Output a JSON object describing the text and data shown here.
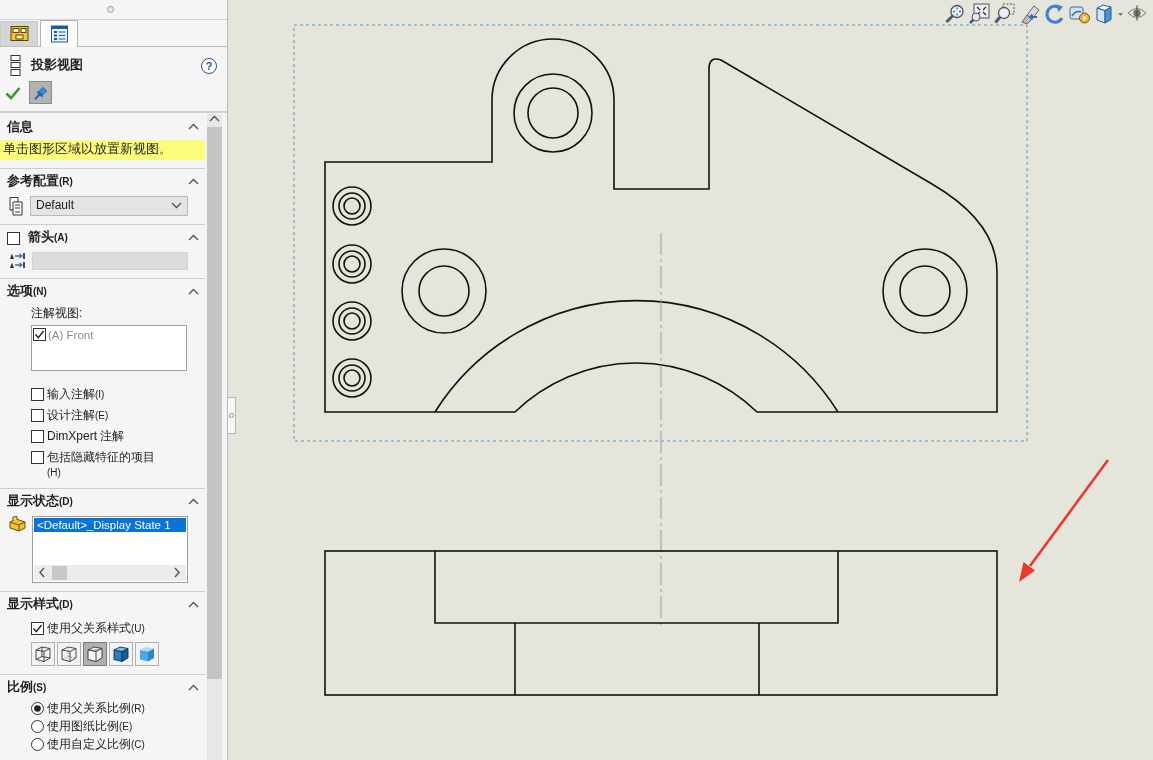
{
  "panel": {
    "tabs": [
      {
        "kind": "features",
        "selected": false
      },
      {
        "kind": "properties",
        "selected": true
      }
    ],
    "title": "投影视图",
    "help": "?",
    "pin_on": true,
    "sections": [
      {
        "title": "信息",
        "expanded": true,
        "controls": [
          {
            "kind": "message",
            "text": "单击图形区域以放置新视图。"
          }
        ]
      },
      {
        "title": "参考配置",
        "shortcut": "(R)",
        "expanded": true,
        "controls": [
          {
            "kind": "select",
            "value": "Default"
          }
        ]
      },
      {
        "title": "箭头",
        "shortcut": "(A)",
        "expanded": true,
        "header_checkbox": {
          "checked": false
        },
        "controls": [
          {
            "kind": "field",
            "disabled": true
          }
        ]
      },
      {
        "title": "选项",
        "shortcut": "(N)",
        "expanded": true,
        "controls": [
          {
            "kind": "label",
            "text": "注解视图:"
          },
          {
            "kind": "checklist",
            "items": [
              {
                "text": "(A) Front",
                "checked": true,
                "disabled": true
              }
            ]
          },
          {
            "kind": "checkbox",
            "text": "输入注解",
            "shortcut": "(I)",
            "checked": false
          },
          {
            "kind": "checkbox",
            "text": "设计注解",
            "shortcut": "(E)",
            "checked": false
          },
          {
            "kind": "checkbox",
            "text": "DimXpert 注解",
            "checked": false
          },
          {
            "kind": "checkbox",
            "text": "包括隐藏特征的项目",
            "shortcut": "(H)",
            "checked": false
          }
        ]
      },
      {
        "title": "显示状态",
        "shortcut": "(D)",
        "expanded": true,
        "controls": [
          {
            "kind": "listbox",
            "items": [
              {
                "text": "<Default>_Display State 1",
                "selected": true
              }
            ]
          }
        ]
      },
      {
        "title": "显示样式",
        "shortcut": "(D)",
        "expanded": true,
        "controls": [
          {
            "kind": "checkbox",
            "text": "使用父关系样式",
            "shortcut": "(U)",
            "checked": true
          },
          {
            "kind": "style_buttons",
            "items": [
              {
                "kind": "wireframe",
                "selected": false
              },
              {
                "kind": "hidden_visible",
                "selected": false
              },
              {
                "kind": "hidden_removed",
                "selected": true
              },
              {
                "kind": "shaded_edges",
                "selected": false
              },
              {
                "kind": "shaded",
                "selected": false
              }
            ]
          }
        ]
      },
      {
        "title": "比例",
        "shortcut": "(S)",
        "expanded": true,
        "controls": [
          {
            "kind": "radio_group",
            "items": [
              {
                "text": "使用父关系比例",
                "shortcut": "(R)",
                "selected": true
              },
              {
                "text": "使用图纸比例",
                "shortcut": "(E)",
                "selected": false
              },
              {
                "text": "使用自定义比例",
                "shortcut": "(C)",
                "selected": false
              }
            ]
          }
        ]
      }
    ]
  }
}
